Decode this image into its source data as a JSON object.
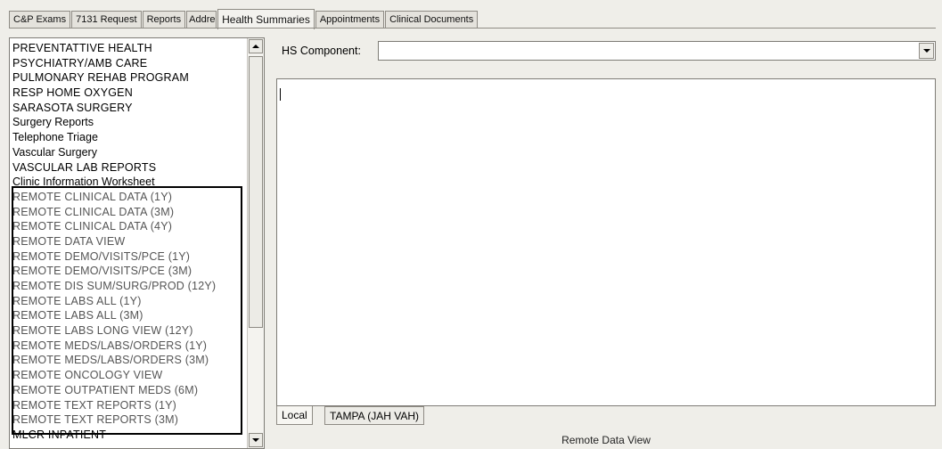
{
  "tabs": [
    {
      "label": "C&P Exams",
      "active": false
    },
    {
      "label": "7131 Request",
      "active": false
    },
    {
      "label": "Reports",
      "active": false
    },
    {
      "label": "Address",
      "active": false
    },
    {
      "label": "Health Summaries",
      "active": true
    },
    {
      "label": "Appointments",
      "active": false
    },
    {
      "label": "Clinical Documents",
      "active": false
    }
  ],
  "list": {
    "items": [
      "PREVENTATTIVE HEALTH",
      "PSYCHIATRY/AMB CARE",
      "PULMONARY REHAB PROGRAM",
      "RESP HOME OXYGEN",
      "SARASOTA SURGERY",
      "Surgery Reports",
      "Telephone Triage",
      "Vascular Surgery",
      "VASCULAR LAB REPORTS",
      "Clinic Information Worksheet",
      "REMOTE CLINICAL DATA (1Y)",
      "REMOTE CLINICAL DATA (3M)",
      "REMOTE CLINICAL DATA (4Y)",
      "REMOTE DATA VIEW",
      "REMOTE DEMO/VISITS/PCE (1Y)",
      "REMOTE DEMO/VISITS/PCE (3M)",
      "REMOTE DIS SUM/SURG/PROD (12Y)",
      "REMOTE LABS ALL (1Y)",
      "REMOTE LABS ALL (3M)",
      "REMOTE LABS LONG VIEW (12Y)",
      "REMOTE MEDS/LABS/ORDERS (1Y)",
      "REMOTE MEDS/LABS/ORDERS (3M)",
      "REMOTE ONCOLOGY VIEW",
      "REMOTE OUTPATIENT MEDS (6M)",
      "REMOTE TEXT REPORTS (1Y)",
      "REMOTE TEXT REPORTS (3M)",
      "MLCR INPATIENT"
    ]
  },
  "hs_component": {
    "label": "HS Component:",
    "value": ""
  },
  "memo": {
    "text": ""
  },
  "bottom_tabs": [
    {
      "label": "Local",
      "active": true
    },
    {
      "label": "TAMPA (JAH VAH)",
      "active": false
    }
  ],
  "status": {
    "text": "Remote Data View"
  },
  "icons": [
    "scroll-up-icon",
    "scroll-down-icon",
    "dropdown-arrow-icon"
  ]
}
